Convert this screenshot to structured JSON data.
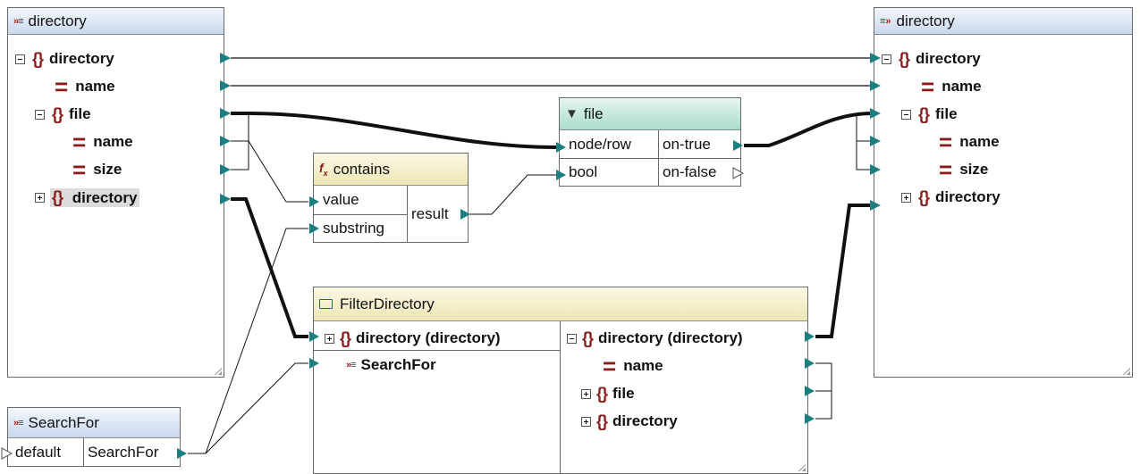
{
  "source_component": {
    "title": "directory",
    "items": [
      {
        "label": "directory",
        "type": "element",
        "expander": "minus"
      },
      {
        "label": "name",
        "type": "attribute"
      },
      {
        "label": "file",
        "type": "element",
        "expander": "minus"
      },
      {
        "label": "name",
        "type": "attribute"
      },
      {
        "label": "size",
        "type": "attribute"
      },
      {
        "label": "directory",
        "type": "element",
        "expander": "plus",
        "selected": true
      }
    ]
  },
  "target_component": {
    "title": "directory",
    "items": [
      {
        "label": "directory",
        "type": "element",
        "expander": "minus"
      },
      {
        "label": "name",
        "type": "attribute"
      },
      {
        "label": "file",
        "type": "element",
        "expander": "minus"
      },
      {
        "label": "name",
        "type": "attribute"
      },
      {
        "label": "size",
        "type": "attribute"
      },
      {
        "label": "directory",
        "type": "element",
        "expander": "plus"
      }
    ]
  },
  "contains_function": {
    "title": "contains",
    "inputs": [
      "value",
      "substring"
    ],
    "output": "result"
  },
  "filter_component": {
    "title": "file",
    "inputs": [
      "node/row",
      "bool"
    ],
    "outputs": [
      "on-true",
      "on-false"
    ]
  },
  "filter_directory_function": {
    "title": "FilterDirectory",
    "inputs": [
      {
        "label": "directory  (directory)",
        "type": "element",
        "expander": "plus"
      },
      {
        "label": "SearchFor",
        "type": "parameter"
      }
    ],
    "outputs": [
      {
        "label": "directory  (directory)",
        "type": "element",
        "expander": "minus"
      },
      {
        "label": "name",
        "type": "attribute"
      },
      {
        "label": "file",
        "type": "element",
        "expander": "plus"
      },
      {
        "label": "directory",
        "type": "element",
        "expander": "plus"
      }
    ]
  },
  "search_for_input": {
    "title": "SearchFor",
    "default_label": "default",
    "output_label": "SearchFor"
  },
  "colors": {
    "connector_teal": "#1a7f80",
    "element_icon": "#8b1a1a",
    "header_blue": "#c9d8ee",
    "header_yellow": "#eee6b4",
    "header_green": "#a9dccb"
  }
}
